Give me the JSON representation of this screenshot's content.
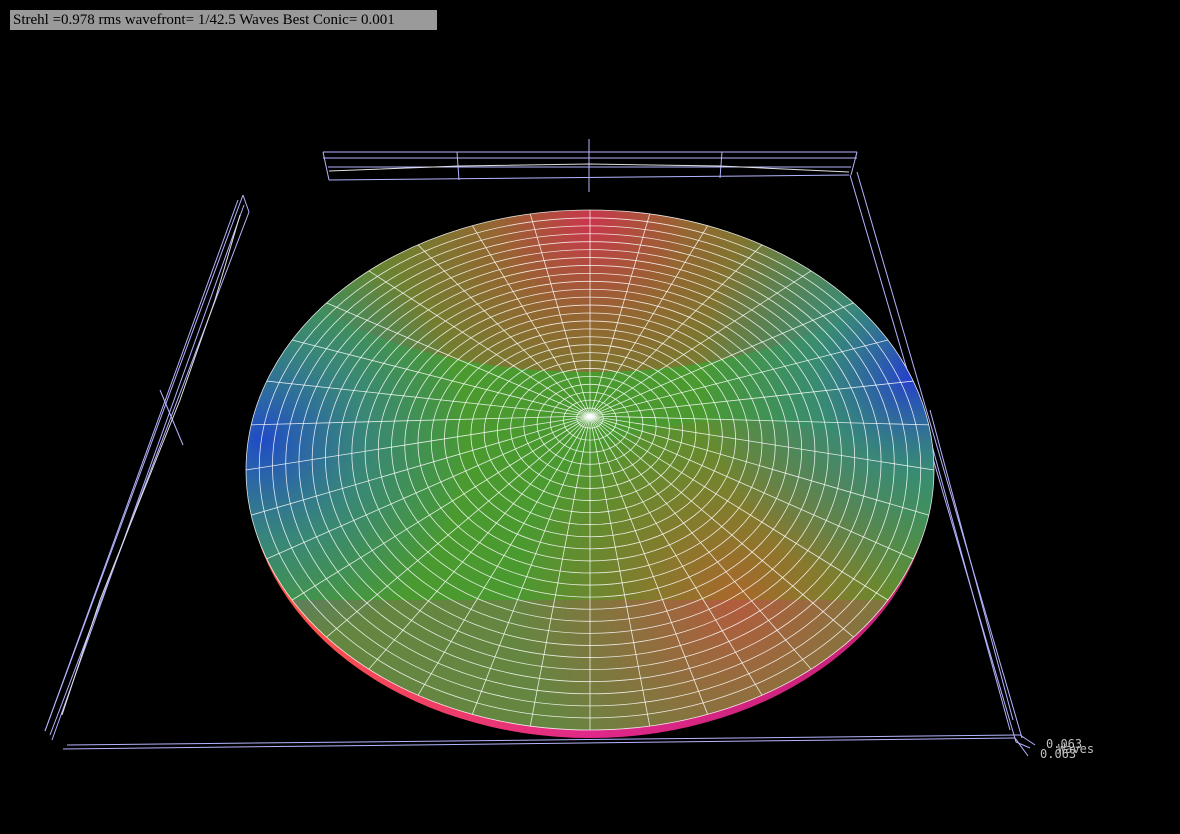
{
  "stats": {
    "strehl_label": "Strehl =",
    "strehl": "0.978",
    "rms_label": "rms wavefront=",
    "rms": "1/42.5",
    "rms_unit": "Waves",
    "conic_label": "Best Conic=",
    "conic": "0.001"
  },
  "scale": {
    "top_value": "0.063",
    "unit": "Waves",
    "bottom_value": "0.063"
  },
  "colors": {
    "background": "#000000",
    "frame": "#b4b4ff",
    "mesh": "#ffffff",
    "stats_bar": "#9a9a9a",
    "red": "#c8324a",
    "green": "#4a9a30",
    "blue": "#2850c8",
    "magenta": "#e02e8c"
  }
}
